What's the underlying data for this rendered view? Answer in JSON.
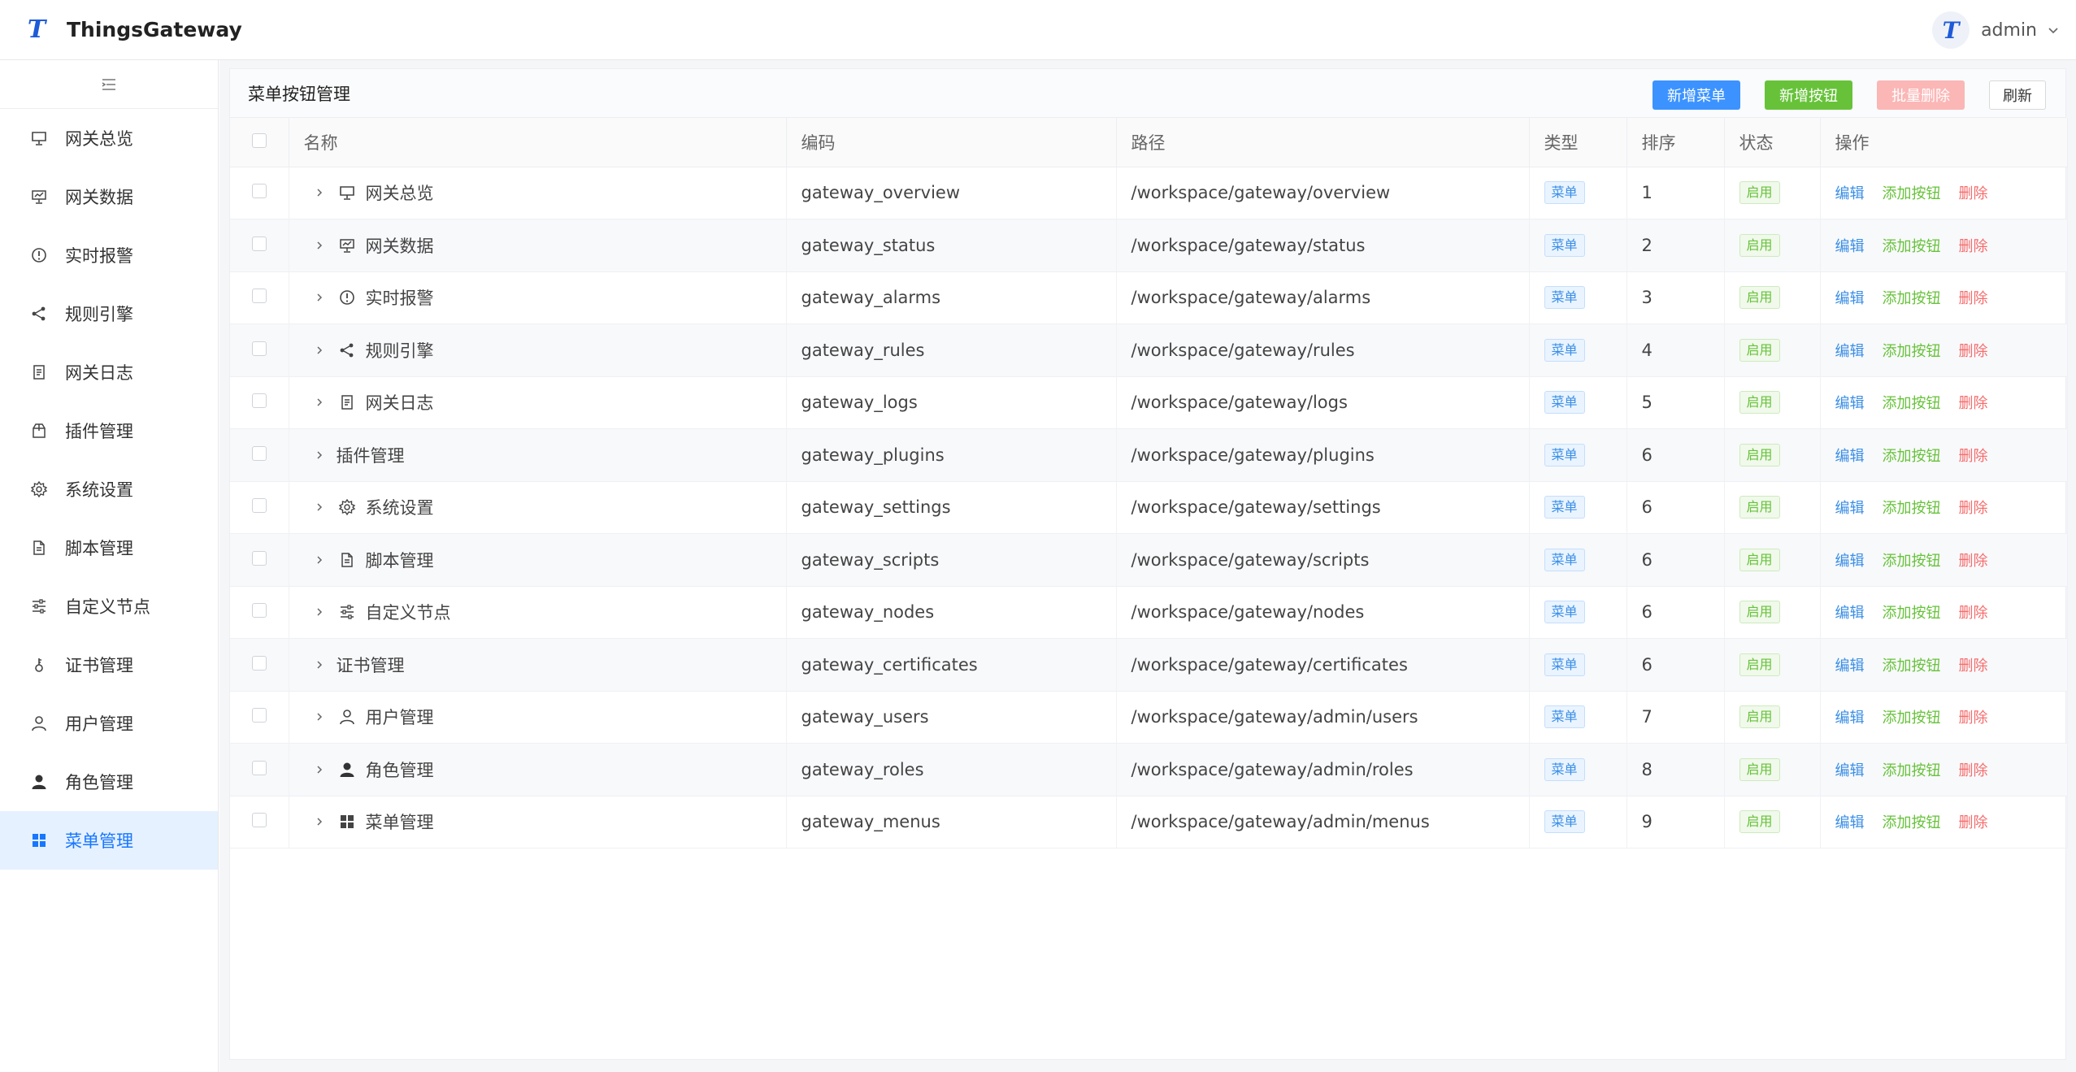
{
  "app": {
    "title": "ThingsGateway",
    "logo_letter": "T"
  },
  "user": {
    "name": "admin",
    "avatar_letter": "T"
  },
  "sidebar": {
    "items": [
      {
        "label": "网关总览",
        "icon": "monitor-icon"
      },
      {
        "label": "网关数据",
        "icon": "chart-board-icon"
      },
      {
        "label": "实时报警",
        "icon": "alert-circle-icon"
      },
      {
        "label": "规则引擎",
        "icon": "share-icon"
      },
      {
        "label": "网关日志",
        "icon": "file-text-icon"
      },
      {
        "label": "插件管理",
        "icon": "package-icon"
      },
      {
        "label": "系统设置",
        "icon": "gear-icon"
      },
      {
        "label": "脚本管理",
        "icon": "file-doc-icon"
      },
      {
        "label": "自定义节点",
        "icon": "sliders-icon"
      },
      {
        "label": "证书管理",
        "icon": "key-icon"
      },
      {
        "label": "用户管理",
        "icon": "user-outline-icon"
      },
      {
        "label": "角色管理",
        "icon": "user-solid-icon"
      },
      {
        "label": "菜单管理",
        "icon": "grid-icon"
      }
    ],
    "active_index": 12
  },
  "page": {
    "title": "菜单按钮管理",
    "buttons": {
      "add_menu": "新增菜单",
      "add_button": "新增按钮",
      "batch_delete": "批量删除",
      "refresh": "刷新"
    },
    "columns": {
      "name": "名称",
      "code": "编码",
      "path": "路径",
      "type": "类型",
      "order": "排序",
      "status": "状态",
      "ops": "操作"
    },
    "ops": {
      "edit": "编辑",
      "add_button": "添加按钮",
      "delete": "删除"
    }
  },
  "rows": [
    {
      "name": "网关总览",
      "icon": "monitor-icon",
      "code": "gateway_overview",
      "path": "/workspace/gateway/overview",
      "type": "菜单",
      "order": "1",
      "status": "启用"
    },
    {
      "name": "网关数据",
      "icon": "chart-board-icon",
      "code": "gateway_status",
      "path": "/workspace/gateway/status",
      "type": "菜单",
      "order": "2",
      "status": "启用"
    },
    {
      "name": "实时报警",
      "icon": "alert-circle-icon",
      "code": "gateway_alarms",
      "path": "/workspace/gateway/alarms",
      "type": "菜单",
      "order": "3",
      "status": "启用"
    },
    {
      "name": "规则引擎",
      "icon": "share-icon",
      "code": "gateway_rules",
      "path": "/workspace/gateway/rules",
      "type": "菜单",
      "order": "4",
      "status": "启用"
    },
    {
      "name": "网关日志",
      "icon": "file-text-icon",
      "code": "gateway_logs",
      "path": "/workspace/gateway/logs",
      "type": "菜单",
      "order": "5",
      "status": "启用"
    },
    {
      "name": "插件管理",
      "icon": "",
      "code": "gateway_plugins",
      "path": "/workspace/gateway/plugins",
      "type": "菜单",
      "order": "6",
      "status": "启用"
    },
    {
      "name": "系统设置",
      "icon": "gear-icon",
      "code": "gateway_settings",
      "path": "/workspace/gateway/settings",
      "type": "菜单",
      "order": "6",
      "status": "启用"
    },
    {
      "name": "脚本管理",
      "icon": "file-doc-icon",
      "code": "gateway_scripts",
      "path": "/workspace/gateway/scripts",
      "type": "菜单",
      "order": "6",
      "status": "启用"
    },
    {
      "name": "自定义节点",
      "icon": "sliders-icon",
      "code": "gateway_nodes",
      "path": "/workspace/gateway/nodes",
      "type": "菜单",
      "order": "6",
      "status": "启用"
    },
    {
      "name": "证书管理",
      "icon": "",
      "code": "gateway_certificates",
      "path": "/workspace/gateway/certificates",
      "type": "菜单",
      "order": "6",
      "status": "启用"
    },
    {
      "name": "用户管理",
      "icon": "user-outline-icon",
      "code": "gateway_users",
      "path": "/workspace/gateway/admin/users",
      "type": "菜单",
      "order": "7",
      "status": "启用"
    },
    {
      "name": "角色管理",
      "icon": "user-solid-icon",
      "code": "gateway_roles",
      "path": "/workspace/gateway/admin/roles",
      "type": "菜单",
      "order": "8",
      "status": "启用"
    },
    {
      "name": "菜单管理",
      "icon": "grid-icon",
      "code": "gateway_menus",
      "path": "/workspace/gateway/admin/menus",
      "type": "菜单",
      "order": "9",
      "status": "启用"
    }
  ],
  "colors": {
    "primary": "#3c93ff",
    "success": "#67c23a",
    "danger": "#f56c6c",
    "active_bg": "#e6f1ff"
  }
}
